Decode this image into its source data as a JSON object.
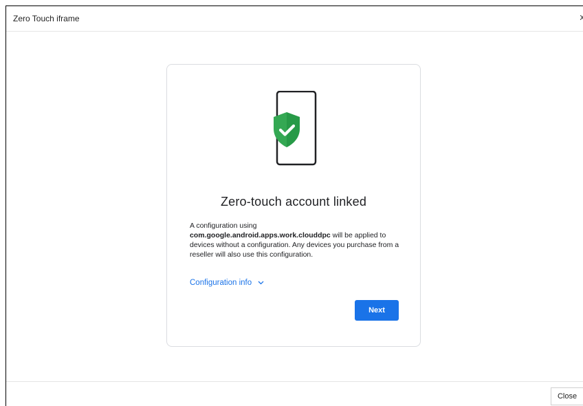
{
  "dialog": {
    "title": "Zero Touch iframe",
    "close_glyph": "x",
    "footer_close_label": "Close"
  },
  "card": {
    "title": "Zero-touch account linked",
    "body_intro": "A configuration using",
    "body_package": "com.google.android.apps.work.clouddpc",
    "body_rest": " will be applied to devices without a configuration. Any devices you purchase from a reseller will also use this configuration.",
    "config_link_label": "Configuration info",
    "next_label": "Next"
  },
  "icons": {
    "illustration": "phone-with-shield-check-icon",
    "chevron": "chevron-down-icon"
  },
  "colors": {
    "accent": "#1a73e8",
    "shield": "#34a853",
    "shield_dark": "#1e8e3e"
  }
}
